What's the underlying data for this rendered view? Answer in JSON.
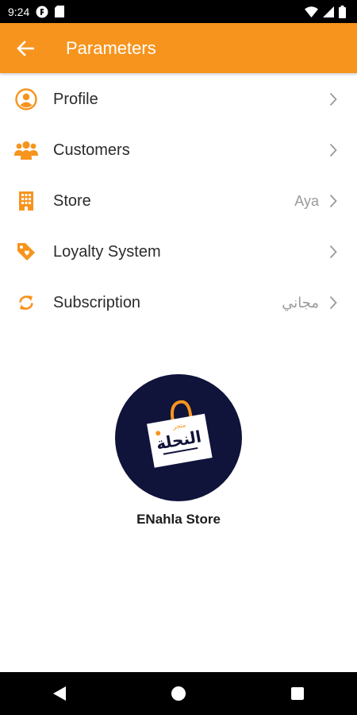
{
  "status_bar": {
    "time": "9:24"
  },
  "app_bar": {
    "title": "Parameters"
  },
  "menu": [
    {
      "label": "Profile",
      "value": "",
      "icon": "profile-icon"
    },
    {
      "label": "Customers",
      "value": "",
      "icon": "customers-icon"
    },
    {
      "label": "Store",
      "value": "Aya",
      "icon": "store-icon"
    },
    {
      "label": "Loyalty System",
      "value": "",
      "icon": "loyalty-tag-icon"
    },
    {
      "label": "Subscription",
      "value": "مجاني",
      "icon": "subscription-refresh-icon"
    }
  ],
  "store": {
    "name": "ENahla Store",
    "logo_text": "النحلة",
    "logo_subtext": "متجر"
  },
  "colors": {
    "accent": "#F7941D",
    "logo_bg": "#10133A"
  }
}
